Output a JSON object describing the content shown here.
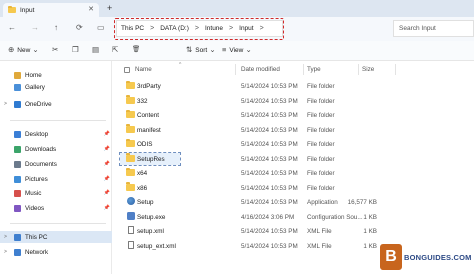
{
  "window": {
    "tab_title": "Input",
    "tab_close": "✕",
    "new_tab": "+"
  },
  "nav": {
    "back": "←",
    "forward": "→",
    "up": "↑",
    "refresh": "⟳",
    "view_icon": "▭",
    "breadcrumb": [
      {
        "label": "This PC"
      },
      {
        "label": "DATA (D:)"
      },
      {
        "label": "Intune"
      },
      {
        "label": "Input"
      }
    ],
    "separator": ">",
    "search_placeholder": "Search Input"
  },
  "toolbar": {
    "new_icon": "⊕",
    "new_label": "New",
    "new_chevron": "⌄",
    "icons": [
      "✂",
      "❐",
      "▤",
      "⇱",
      "🗑"
    ],
    "sort_icon": "⇅",
    "sort_label": "Sort",
    "sort_chevron": "⌄",
    "view_icon": "≡",
    "view_label": "View",
    "view_chevron": "⌄"
  },
  "sidebar": {
    "items": [
      {
        "label": "Home",
        "color": "#e0a93b",
        "chevron": "",
        "pinned": false
      },
      {
        "label": "Gallery",
        "color": "#4a90d9",
        "chevron": "",
        "pinned": false
      },
      {
        "label": "OneDrive",
        "color": "#2f7bd1",
        "chevron": ">",
        "pinned": false
      },
      {
        "label": "Desktop",
        "color": "#3b7fd6",
        "chevron": "",
        "pinned": true
      },
      {
        "label": "Downloads",
        "color": "#3ba46a",
        "chevron": "",
        "pinned": true
      },
      {
        "label": "Documents",
        "color": "#6b7a8c",
        "chevron": "",
        "pinned": true
      },
      {
        "label": "Pictures",
        "color": "#3f8ed8",
        "chevron": "",
        "pinned": true
      },
      {
        "label": "Music",
        "color": "#d6504c",
        "chevron": "",
        "pinned": true
      },
      {
        "label": "Videos",
        "color": "#8057c2",
        "chevron": "",
        "pinned": true
      },
      {
        "label": "This PC",
        "color": "#3f7fcf",
        "chevron": ">",
        "pinned": false
      },
      {
        "label": "Network",
        "color": "#3f7fcf",
        "chevron": ">",
        "pinned": false
      }
    ],
    "pin_glyph": "📌"
  },
  "columns": {
    "name": "Name",
    "date": "Date modified",
    "type": "Type",
    "size": "Size",
    "sort_arrow": "^"
  },
  "files": [
    {
      "name": "3rdParty",
      "date": "5/14/2024 10:53 PM",
      "type": "File folder",
      "size": "",
      "kind": "folder"
    },
    {
      "name": "332",
      "date": "5/14/2024 10:53 PM",
      "type": "File folder",
      "size": "",
      "kind": "folder"
    },
    {
      "name": "Content",
      "date": "5/14/2024 10:53 PM",
      "type": "File folder",
      "size": "",
      "kind": "folder"
    },
    {
      "name": "manifest",
      "date": "5/14/2024 10:53 PM",
      "type": "File folder",
      "size": "",
      "kind": "folder"
    },
    {
      "name": "ODIS",
      "date": "5/14/2024 10:53 PM",
      "type": "File folder",
      "size": "",
      "kind": "folder"
    },
    {
      "name": "SetupRes",
      "date": "5/14/2024 10:53 PM",
      "type": "File folder",
      "size": "",
      "kind": "folder",
      "selected": true
    },
    {
      "name": "x64",
      "date": "5/14/2024 10:53 PM",
      "type": "File folder",
      "size": "",
      "kind": "folder"
    },
    {
      "name": "x86",
      "date": "5/14/2024 10:53 PM",
      "type": "File folder",
      "size": "",
      "kind": "folder"
    },
    {
      "name": "Setup",
      "date": "5/14/2024 10:53 PM",
      "type": "Application",
      "size": "16,577 KB",
      "kind": "setup"
    },
    {
      "name": "Setup.exe",
      "date": "4/16/2024 3:06 PM",
      "type": "Configuration Sou...",
      "size": "1 KB",
      "kind": "exe"
    },
    {
      "name": "setup.xml",
      "date": "5/14/2024 10:53 PM",
      "type": "XML File",
      "size": "1 KB",
      "kind": "file"
    },
    {
      "name": "setup_ext.xml",
      "date": "5/14/2024 10:53 PM",
      "type": "XML File",
      "size": "1 KB",
      "kind": "file"
    }
  ],
  "watermark": {
    "badge": "B",
    "brand": "BONGUIDES.COM"
  }
}
